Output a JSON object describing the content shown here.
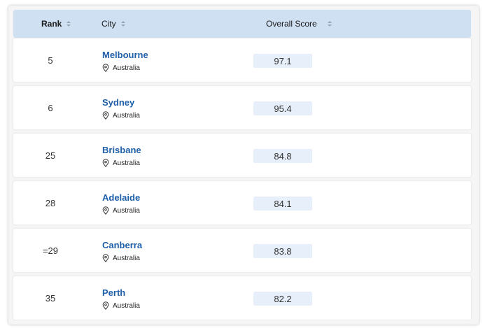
{
  "table": {
    "columns": {
      "rank": "Rank",
      "city": "City",
      "score": "Overall Score"
    },
    "icons": {
      "sort": "sort-icon",
      "location": "map-pin-icon"
    },
    "colors": {
      "header_bg": "#cfe0f3",
      "city_link": "#1f5fa8",
      "score_bg": "#e6effa"
    },
    "rows": [
      {
        "rank": "5",
        "city": "Melbourne",
        "country": "Australia",
        "score": "97.1"
      },
      {
        "rank": "6",
        "city": "Sydney",
        "country": "Australia",
        "score": "95.4"
      },
      {
        "rank": "25",
        "city": "Brisbane",
        "country": "Australia",
        "score": "84.8"
      },
      {
        "rank": "28",
        "city": "Adelaide",
        "country": "Australia",
        "score": "84.1"
      },
      {
        "rank": "=29",
        "city": "Canberra",
        "country": "Australia",
        "score": "83.8"
      },
      {
        "rank": "35",
        "city": "Perth",
        "country": "Australia",
        "score": "82.2"
      }
    ]
  }
}
